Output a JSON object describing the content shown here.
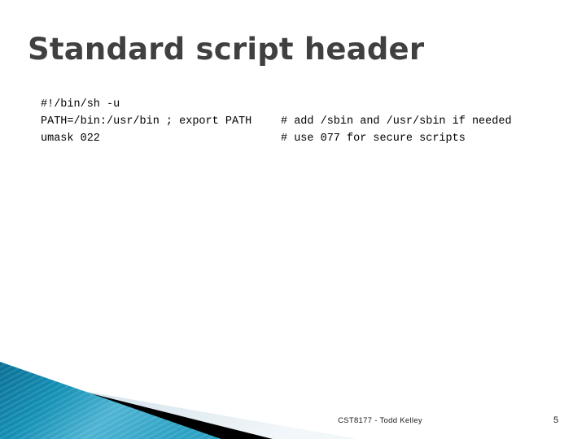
{
  "slide": {
    "title": "Standard script header",
    "title_color": "#404040",
    "background_color": "#ffffff"
  },
  "code": {
    "lines": [
      {
        "left": "#!/bin/sh -u",
        "right": ""
      },
      {
        "left": "PATH=/bin:/usr/bin ; export PATH",
        "right": "# add /sbin and /usr/sbin if needed"
      },
      {
        "left": "umask 022",
        "right": "# use 077 for secure scripts"
      }
    ]
  },
  "footer": {
    "course_and_author": "CST8177 - Todd Kelley",
    "page_number": "5"
  },
  "decoration": {
    "teal_dark": "#0a7ca0",
    "teal_light": "#6ec6de",
    "stripe_black": "#000000",
    "pale_blue": "#dde8ee"
  }
}
